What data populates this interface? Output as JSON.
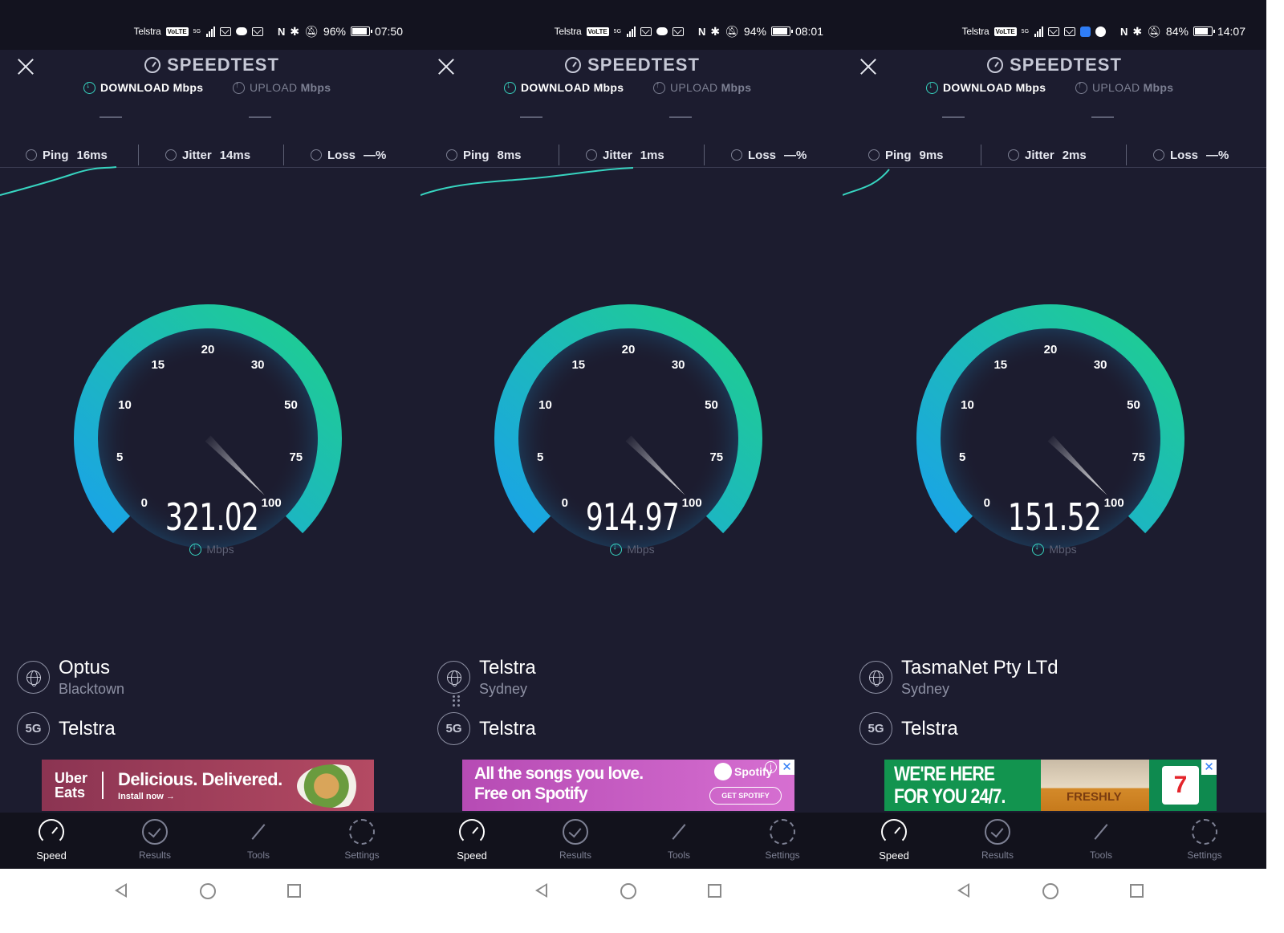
{
  "colors": {
    "background": "#1c1c2f",
    "accent": "#37d4c0",
    "gauge_start": "#1aa3e8",
    "gauge_end": "#1fd08c"
  },
  "app": {
    "title": "SPEEDTEST",
    "download_label": "DOWNLOAD",
    "upload_label": "UPLOAD",
    "unit": "Mbps",
    "ping_label": "Ping",
    "jitter_label": "Jitter",
    "loss_label": "Loss",
    "gauge_ticks": [
      "0",
      "5",
      "10",
      "15",
      "20",
      "30",
      "50",
      "75",
      "100"
    ]
  },
  "tabs": [
    {
      "label": "Speed",
      "icon": "speed-gauge-icon"
    },
    {
      "label": "Results",
      "icon": "check-circle-icon"
    },
    {
      "label": "Tools",
      "icon": "magic-wand-icon"
    },
    {
      "label": "Settings",
      "icon": "gear-icon"
    }
  ],
  "screens": [
    {
      "status": {
        "carrier": "Telstra",
        "network": "5G",
        "battery": "96%",
        "battery_level": 0.96,
        "time": "07:50"
      },
      "ping": "16ms",
      "jitter": "14ms",
      "loss": "—%",
      "speed": "321.02",
      "server": {
        "name": "Optus",
        "location": "Blacktown"
      },
      "connection": {
        "type": "5G",
        "provider": "Telstra"
      },
      "ad": {
        "brand_line1": "Uber",
        "brand_line2": "Eats",
        "headline": "Delicious. Delivered.",
        "cta": "Install now →"
      }
    },
    {
      "status": {
        "carrier": "Telstra",
        "network": "5G",
        "battery": "94%",
        "battery_level": 0.94,
        "time": "08:01"
      },
      "ping": "8ms",
      "jitter": "1ms",
      "loss": "—%",
      "speed": "914.97",
      "server": {
        "name": "Telstra",
        "location": "Sydney"
      },
      "connection": {
        "type": "5G",
        "provider": "Telstra"
      },
      "ad": {
        "headline": "All the songs you love.",
        "headline2": "Free on Spotify",
        "brand": "Spotify",
        "cta": "GET SPOTIFY"
      }
    },
    {
      "status": {
        "carrier": "Telstra",
        "network": "5G",
        "battery": "84%",
        "battery_level": 0.84,
        "time": "14:07"
      },
      "ping": "9ms",
      "jitter": "2ms",
      "loss": "—%",
      "speed": "151.52",
      "server": {
        "name": "TasmaNet Pty LTd",
        "location": "Sydney"
      },
      "connection": {
        "type": "5G",
        "provider": "Telstra"
      },
      "ad": {
        "headline": "WE'RE HERE",
        "headline2": "FOR YOU 24/7.",
        "product_text": "FRESHLY",
        "brand": "7 ELEVEN"
      }
    }
  ]
}
